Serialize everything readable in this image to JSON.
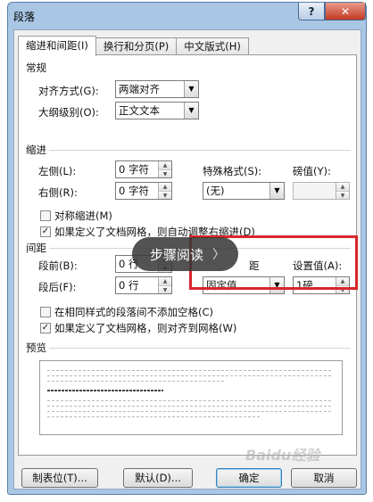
{
  "window": {
    "title": "段落",
    "help": "?",
    "close": "✕"
  },
  "tabs": [
    {
      "label": "缩进和间距(I)"
    },
    {
      "label": "换行和分页(P)"
    },
    {
      "label": "中文版式(H)"
    }
  ],
  "general": {
    "heading": "常规",
    "alignment": {
      "label": "对齐方式(G):",
      "value": "两端对齐"
    },
    "outline": {
      "label": "大纲级别(O):",
      "value": "正文文本"
    }
  },
  "indent": {
    "heading": "缩进",
    "left": {
      "label": "左侧(L):",
      "value": "0 字符"
    },
    "right": {
      "label": "右侧(R):",
      "value": "0 字符"
    },
    "special": {
      "label": "特殊格式(S):",
      "value": "(无)"
    },
    "by": {
      "label": "磅值(Y):",
      "value": ""
    },
    "mirror": {
      "label": "对称缩进(M)",
      "checked": false
    },
    "auto_adjust": {
      "label": "如果定义了文档网格，则自动调整右缩进(D)",
      "checked": true
    }
  },
  "spacing": {
    "heading": "间距",
    "before": {
      "label": "段前(B):",
      "value": "0 行"
    },
    "after": {
      "label": "段后(F):",
      "value": "0 行"
    },
    "line_spacing_label_partial": "距",
    "line_spacing": {
      "value": "固定值"
    },
    "at": {
      "label": "设置值(A):",
      "value": "1磅"
    },
    "no_space_same_style": {
      "label": "在相同样式的段落间不添加空格(C)",
      "checked": false
    },
    "snap_grid": {
      "label": "如果定义了文档网格，则对齐到网格(W)",
      "checked": true
    }
  },
  "preview": {
    "heading": "预览"
  },
  "buttons": {
    "tabs": "制表位(T)...",
    "default": "默认(D)...",
    "ok": "确定",
    "cancel": "取消"
  },
  "overlay": {
    "text": "步骤阅读",
    "chevron": "〉"
  },
  "watermark": "Baidu经验",
  "icons": {
    "dropdown": "▼",
    "spin_up": "▲",
    "spin_down": "▼",
    "check": "✓"
  },
  "colors": {
    "highlight": "#d9262b",
    "overlay_bg": "#373737",
    "title_bg": "#a9c6e4"
  }
}
